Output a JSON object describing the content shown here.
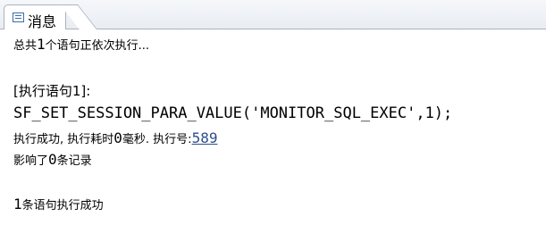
{
  "tab": {
    "label": "消息",
    "icon": "message-panel-icon"
  },
  "messages": {
    "summary_prefix": "总共",
    "summary_count": "1",
    "summary_suffix": "个语句正依次执行...",
    "stmt_header": "[执行语句1]:",
    "sql": "SF_SET_SESSION_PARA_VALUE('MONITOR_SQL_EXEC',1);",
    "result_prefix": "执行成功, 执行耗时",
    "elapsed_value": "0",
    "result_mid": "毫秒. 执行号:",
    "exec_id": "589",
    "affected_prefix": "影响了",
    "affected_count": "0",
    "affected_suffix": "条记录",
    "final_count": "1",
    "final_suffix": "条语句执行成功"
  },
  "colors": {
    "link": "#2e4d8f",
    "tab_border": "#a9b3bf"
  }
}
